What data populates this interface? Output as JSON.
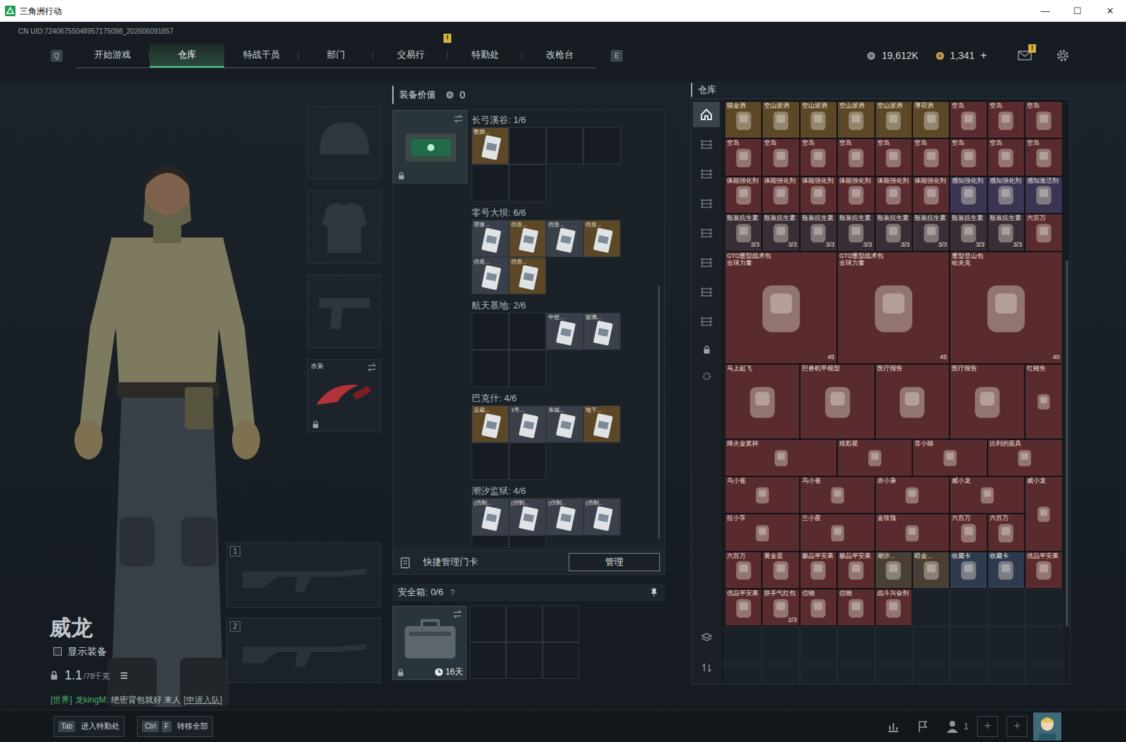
{
  "window": {
    "title": "三角洲行动",
    "controls": [
      "—",
      "☐",
      "✕"
    ]
  },
  "uid": "CN UID:72406755048957175098_202606091857",
  "nav": {
    "prev_key": "Q",
    "next_key": "E",
    "tabs": [
      {
        "label": "开始游戏",
        "selected": false,
        "badge": ""
      },
      {
        "label": "仓库",
        "selected": true,
        "badge": ""
      },
      {
        "label": "特战干员",
        "selected": false,
        "badge": ""
      },
      {
        "label": "部门",
        "selected": false,
        "badge": ""
      },
      {
        "label": "交易行",
        "selected": false,
        "badge": ""
      },
      {
        "label": "特勤处",
        "selected": false,
        "badge": "!"
      },
      {
        "label": "改枪台",
        "selected": false,
        "badge": ""
      }
    ]
  },
  "wallet": {
    "coins": "19,612K",
    "tokens": "1,341",
    "add": "+"
  },
  "mail": {
    "badge": "!"
  },
  "loadout": {
    "equipment": [
      {
        "kind": "helmet",
        "locked": false
      },
      {
        "kind": "armor",
        "locked": false
      },
      {
        "kind": "pistol",
        "locked": false
      },
      {
        "kind": "melee",
        "label": "赤枭",
        "locked": true
      }
    ],
    "weapons": [
      {
        "slot": "1"
      },
      {
        "slot": "2"
      }
    ]
  },
  "operator": {
    "name": "威龙",
    "show_gear_label": "显示装备",
    "show_gear": false,
    "weight": "1.1",
    "weight_max": "/78千克"
  },
  "chat": {
    "channel": "[世界]",
    "sender": "龙kingM:",
    "message": "绝密背包就好 来人",
    "action": "[申请入队]"
  },
  "equipment_value": {
    "label": "装备价值",
    "value": "0"
  },
  "keycard_holder": {
    "locked": true,
    "sections": [
      {
        "title": "长弓溪谷: 1/6",
        "slots": [
          {
            "filled": true,
            "label": "数据...",
            "color": "#5c4727"
          },
          {
            "filled": false
          },
          {
            "filled": false
          },
          {
            "filled": false
          },
          {
            "filled": false
          },
          {
            "filled": false
          }
        ]
      },
      {
        "title": "零号大坝: 6/6",
        "slots": [
          {
            "filled": true,
            "label": "宿舍...",
            "color": "#3a3f4a"
          },
          {
            "filled": true,
            "label": "仿造...",
            "color": "#5c4727"
          },
          {
            "filled": true,
            "label": "仿造...",
            "color": "#3a3f4a"
          },
          {
            "filled": true,
            "label": "仿造...",
            "color": "#5c4727"
          },
          {
            "filled": true,
            "label": "仿造...",
            "color": "#3a3f4a"
          },
          {
            "filled": true,
            "label": "仿造...",
            "color": "#5c4727"
          }
        ]
      },
      {
        "title": "航天基地: 2/6",
        "slots": [
          {
            "filled": false
          },
          {
            "filled": false
          },
          {
            "filled": true,
            "label": "中控...",
            "color": "#3a3f4a"
          },
          {
            "filled": true,
            "label": "玻璃...",
            "color": "#3a3f4a"
          },
          {
            "filled": false
          },
          {
            "filled": false
          }
        ]
      },
      {
        "title": "巴克什: 4/6",
        "slots": [
          {
            "filled": true,
            "label": "总裁...",
            "color": "#5c4727"
          },
          {
            "filled": true,
            "label": "1号...",
            "color": "#3a3f4a"
          },
          {
            "filled": true,
            "label": "东城...",
            "color": "#3a3f4a"
          },
          {
            "filled": true,
            "label": "地下...",
            "color": "#5c4727"
          },
          {
            "filled": false
          },
          {
            "filled": false
          }
        ]
      },
      {
        "title": "潮汐监狱: 4/6",
        "slots": [
          {
            "filled": true,
            "label": "(仿制...",
            "color": "#3a3f4a"
          },
          {
            "filled": true,
            "label": "(仿制...",
            "color": "#3a3f4a"
          },
          {
            "filled": true,
            "label": "(仿制...",
            "color": "#3a3f4a"
          },
          {
            "filled": true,
            "label": "(仿制...",
            "color": "#3a3f4a"
          },
          {
            "filled": false
          },
          {
            "filled": false
          }
        ]
      }
    ]
  },
  "keycard_manage": {
    "label": "快捷管理门卡",
    "button": "管理"
  },
  "safe_box": {
    "label": "安全箱:",
    "count": "0/6",
    "help": "?",
    "timer": "16天",
    "locked": true
  },
  "warehouse": {
    "title": "仓库",
    "side_tabs": [
      {
        "selected": true
      },
      {
        "selected": false
      },
      {
        "selected": false
      },
      {
        "selected": false
      },
      {
        "selected": false
      },
      {
        "selected": false
      },
      {
        "selected": false
      },
      {
        "selected": false
      }
    ],
    "items": [
      {
        "name": "猫金酒",
        "color": "#5c4727"
      },
      {
        "name": "空山派酒",
        "color": "#5c4727"
      },
      {
        "name": "空山派酒",
        "color": "#5c4727"
      },
      {
        "name": "空山派酒",
        "color": "#5c4727"
      },
      {
        "name": "空山派酒",
        "color": "#5c4727"
      },
      {
        "name": "薄荷酒",
        "color": "#5c4727"
      },
      {
        "name": "空岛",
        "color": "#5a2b2e"
      },
      {
        "name": "空岛",
        "color": "#5a2b2e"
      },
      {
        "name": "空岛",
        "color": "#5a2b2e"
      },
      {
        "name": "空岛",
        "color": "#5a2b2e"
      },
      {
        "name": "空岛",
        "color": "#5a2b2e"
      },
      {
        "name": "空岛",
        "color": "#5a2b2e"
      },
      {
        "name": "空岛",
        "color": "#5a2b2e"
      },
      {
        "name": "空岛",
        "color": "#5a2b2e"
      },
      {
        "name": "空岛",
        "color": "#5a2b2e"
      },
      {
        "name": "空岛",
        "color": "#5a2b2e"
      },
      {
        "name": "空岛",
        "color": "#5a2b2e"
      },
      {
        "name": "空岛",
        "color": "#5a2b2e"
      },
      {
        "name": "体能强化剂",
        "color": "#5a2b2e"
      },
      {
        "name": "体能强化剂",
        "color": "#5a2b2e"
      },
      {
        "name": "体能强化剂",
        "color": "#5a2b2e"
      },
      {
        "name": "体能强化剂",
        "color": "#5a2b2e"
      },
      {
        "name": "体能强化剂",
        "color": "#5a2b2e"
      },
      {
        "name": "体能强化剂",
        "color": "#5a2b2e"
      },
      {
        "name": "感知强化剂",
        "color": "#3b3553"
      },
      {
        "name": "感知强化剂",
        "color": "#3b3553"
      },
      {
        "name": "感知激活剂",
        "color": "#3b3553"
      },
      {
        "name": "瓶装抗生素",
        "color": "#3a2e36",
        "count": "3/3"
      },
      {
        "name": "瓶装抗生素",
        "color": "#3a2e36",
        "count": "3/3"
      },
      {
        "name": "瓶装抗生素",
        "color": "#3a2e36",
        "count": "3/3"
      },
      {
        "name": "瓶装抗生素",
        "color": "#3a2e36",
        "count": "3/3"
      },
      {
        "name": "瓶装抗生素",
        "color": "#3a2e36",
        "count": "3/3"
      },
      {
        "name": "瓶装抗生素",
        "color": "#3a2e36",
        "count": "3/3"
      },
      {
        "name": "瓶装抗生素",
        "color": "#3a2e36",
        "count": "3/3"
      },
      {
        "name": "瓶装抗生素",
        "color": "#3a2e36",
        "count": "3/3"
      },
      {
        "name": "六百万",
        "color": "#5a2b2e"
      },
      {
        "name": "GTO重型战术包",
        "sub": "全球力量",
        "color": "#5a2b2e",
        "count": "45"
      },
      {
        "name": "GTO重型战术包",
        "sub": "全球力量",
        "color": "#5a2b2e",
        "count": "45"
      },
      {
        "name": "重型登山包",
        "sub": "哈夫克",
        "color": "#5a2b2e",
        "count": "40"
      },
      {
        "name": "马上起飞",
        "color": "#5a2b2e"
      },
      {
        "name": "巨兽机甲模型",
        "color": "#5a2b2e"
      },
      {
        "name": "医疗报告",
        "color": "#5a2b2e"
      },
      {
        "name": "医疗报告",
        "color": "#5a2b2e"
      },
      {
        "name": "红鲤鱼",
        "color": "#5a2b2e"
      },
      {
        "name": "烽火金奖杯",
        "color": "#5a2b2e"
      },
      {
        "name": "炫彩星",
        "color": "#5a2b2e"
      },
      {
        "name": "青小猫",
        "color": "#5a2b2e"
      },
      {
        "name": "比利的面具",
        "color": "#5a2b2e"
      },
      {
        "name": "乌小雀",
        "color": "#5a2b2e"
      },
      {
        "name": "乌小雀",
        "color": "#5a2b2e"
      },
      {
        "name": "赤小枭",
        "color": "#5a2b2e"
      },
      {
        "name": "威小龙",
        "color": "#5a2b2e"
      },
      {
        "name": "威小龙",
        "color": "#5a2b2e"
      },
      {
        "name": "拉小孚",
        "color": "#5a2b2e"
      },
      {
        "name": "兰小星",
        "color": "#5a2b2e"
      },
      {
        "name": "金玫瑰",
        "color": "#5a2b2e"
      },
      {
        "name": "六百万",
        "color": "#5a2b2e"
      },
      {
        "name": "六百万",
        "color": "#5a2b2e"
      },
      {
        "name": "六百万",
        "color": "#5a2b2e"
      },
      {
        "name": "黄金蛋",
        "color": "#5a2b2e"
      },
      {
        "name": "极品平安果",
        "color": "#5a2b2e"
      },
      {
        "name": "极品平安果",
        "color": "#5a2b2e"
      },
      {
        "name": "潮汐...",
        "color": "#4a3f35"
      },
      {
        "name": "暗金...",
        "color": "#4a3f35"
      },
      {
        "name": "收藏卡",
        "color": "#2e3b4f"
      },
      {
        "name": "收藏卡",
        "color": "#2e3b4f"
      },
      {
        "name": "优品平安果",
        "color": "#5a2b2e"
      },
      {
        "name": "优品平安果",
        "color": "#5a2b2e"
      },
      {
        "name": "拼手气红包",
        "color": "#5a2b2e",
        "count": "2/3"
      },
      {
        "name": "信物",
        "color": "#5a2b2e"
      },
      {
        "name": "信物",
        "color": "#5a2b2e"
      },
      {
        "name": "战斗兴奋剂",
        "color": "#5a2b2e"
      }
    ]
  },
  "bottom": {
    "actions": [
      {
        "keys": [
          "Tab"
        ],
        "label": "进入特勤处"
      },
      {
        "keys": [
          "Ctrl",
          "F"
        ],
        "label": "转移全部"
      }
    ],
    "squad_count": "1",
    "slots": [
      "+",
      "+"
    ]
  }
}
